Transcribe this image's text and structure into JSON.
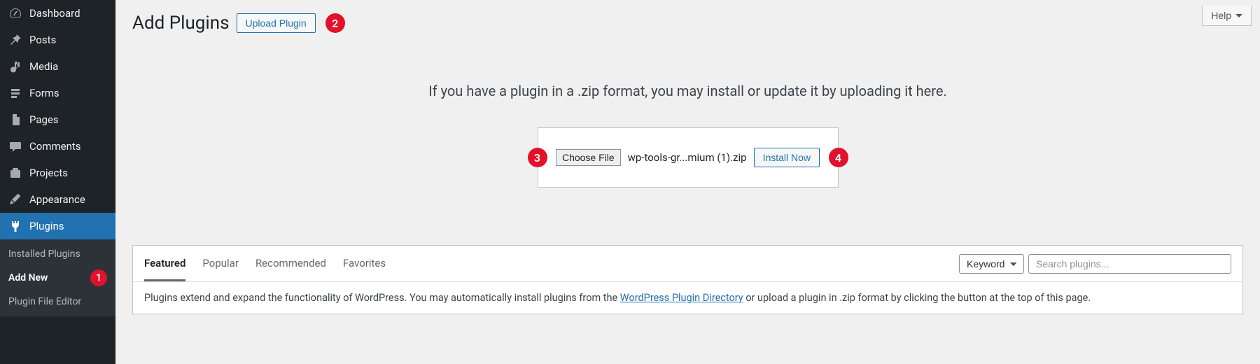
{
  "sidebar": {
    "items": [
      {
        "label": "Dashboard",
        "icon": "dashboard"
      },
      {
        "label": "Posts",
        "icon": "pin"
      },
      {
        "label": "Media",
        "icon": "media"
      },
      {
        "label": "Forms",
        "icon": "form"
      },
      {
        "label": "Pages",
        "icon": "page"
      },
      {
        "label": "Comments",
        "icon": "comment"
      },
      {
        "label": "Projects",
        "icon": "portfolio"
      },
      {
        "label": "Appearance",
        "icon": "brush"
      },
      {
        "label": "Plugins",
        "icon": "plug",
        "active": true
      }
    ],
    "submenu": [
      {
        "label": "Installed Plugins"
      },
      {
        "label": "Add New",
        "active": true,
        "badge": "1"
      },
      {
        "label": "Plugin File Editor"
      }
    ]
  },
  "help_label": "Help",
  "page_title": "Add Plugins",
  "upload_plugin_label": "Upload Plugin",
  "badge_2": "2",
  "upload_instructions": "If you have a plugin in a .zip format, you may install or update it by uploading it here.",
  "badge_3": "3",
  "choose_file_label": "Choose File",
  "file_name": "wp-tools-gr...mium (1).zip",
  "install_now_label": "Install Now",
  "badge_4": "4",
  "tabs": [
    {
      "label": "Featured",
      "active": true
    },
    {
      "label": "Popular"
    },
    {
      "label": "Recommended"
    },
    {
      "label": "Favorites"
    }
  ],
  "keyword_label": "Keyword",
  "search_placeholder": "Search plugins...",
  "desc_prefix": "Plugins extend and expand the functionality of WordPress. You may automatically install plugins from the ",
  "desc_link": "WordPress Plugin Directory",
  "desc_suffix": " or upload a plugin in .zip format by clicking the button at the top of this page."
}
